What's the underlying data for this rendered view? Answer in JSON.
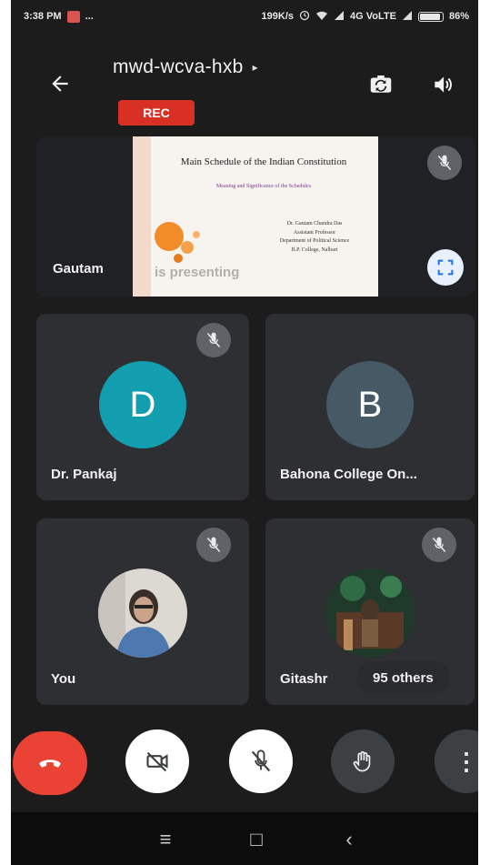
{
  "status_bar": {
    "time": "3:38 PM",
    "dots": "...",
    "speed": "199K/s",
    "network": "4G VoLTE",
    "battery": "86%",
    "battery_level": 0.86
  },
  "header": {
    "meeting_code": "mwd-wcva-hxb",
    "caret": "▸",
    "rec_label": "REC"
  },
  "presentation": {
    "presenter_name": "Gautam",
    "presenting_text": "is presenting",
    "slide": {
      "title": "Main Schedule of the Indian Constitution",
      "subtitle": "Meaning and Significance of the Schedules",
      "author_lines": [
        "Dr. Gautam Chandra Das",
        "Assistant Professor",
        "Department of Political Science",
        "B.P. College, Nalbari"
      ]
    }
  },
  "participants": [
    {
      "name": "Dr. Pankaj",
      "initial": "D",
      "color": "#129eaf"
    },
    {
      "name": "Bahona College On...",
      "initial": "B",
      "color": "#455a64"
    },
    {
      "name": "You"
    },
    {
      "name": "Gitashr"
    }
  ],
  "others_label": "95 others",
  "controls": {
    "more_label": "⋮"
  },
  "nav": {
    "menu": "≡",
    "home": "□",
    "back": "‹"
  }
}
